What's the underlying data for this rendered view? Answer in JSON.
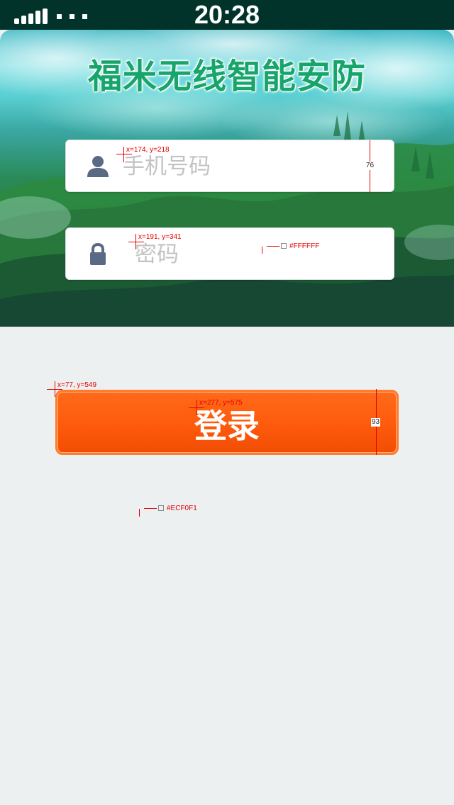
{
  "status_bar": {
    "time": "20:28"
  },
  "app_title": "福米无线智能安防",
  "phone_input": {
    "placeholder": "手机号码",
    "value": "",
    "icon": "user-icon"
  },
  "password_input": {
    "placeholder": "密码",
    "value": "",
    "icon": "lock-icon"
  },
  "login_button": {
    "label": "登录"
  },
  "colors": {
    "input_background": "#FFFFFF",
    "page_background": "#ECF0F1",
    "button": "#FE5A0C",
    "title": "#17A56B"
  },
  "annotations": {
    "phone_coord": "x=174, y=218",
    "phone_height": "76",
    "password_coord": "x=191, y=341",
    "input_color": "#FFFFFF",
    "button_coord": "x=77, y=549",
    "label_coord": "x=277, y=575",
    "button_height": "93",
    "background_color": "#ECF0F1"
  }
}
